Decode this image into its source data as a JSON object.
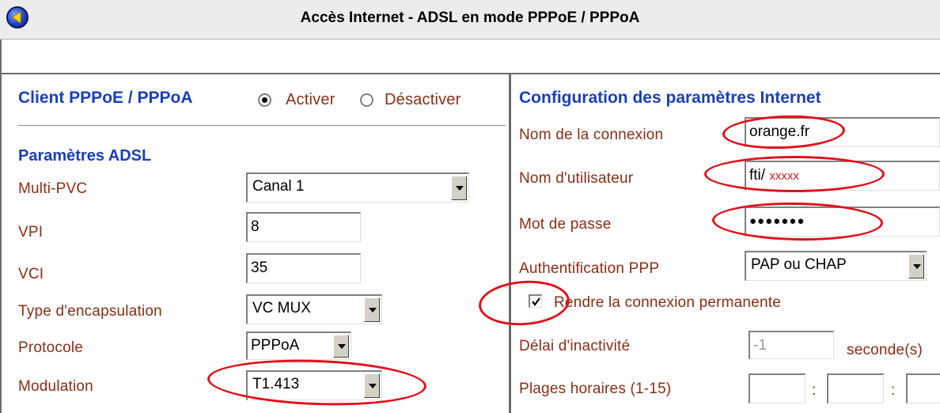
{
  "window": {
    "title": "Accès Internet - ADSL en mode PPPoE / PPPoA",
    "back_icon": "back-arrow-icon"
  },
  "left": {
    "client_label": "Client PPPoE / PPPoA",
    "activate_label": "Activer",
    "deactivate_label": "Désactiver",
    "client_selected": "Activer",
    "adsl_heading": "Paramètres ADSL",
    "fields": {
      "multipvc": {
        "label": "Multi-PVC",
        "value": "Canal 1"
      },
      "vpi": {
        "label": "VPI",
        "value": "8"
      },
      "vci": {
        "label": "VCI",
        "value": "35"
      },
      "encapsulation": {
        "label": "Type d'encapsulation",
        "value": "VC MUX"
      },
      "protocol": {
        "label": "Protocole",
        "value": "PPPoA"
      },
      "modulation": {
        "label": "Modulation",
        "value": "T1.413"
      }
    }
  },
  "right": {
    "heading": "Configuration des paramètres Internet",
    "fields": {
      "connection_name": {
        "label": "Nom de la connexion",
        "value": "orange.fr"
      },
      "username": {
        "label": "Nom d'utilisateur",
        "value_prefix": "fti/",
        "value_masked": "xxxxx"
      },
      "password": {
        "label": "Mot de passe",
        "value": "●●●●●●●"
      },
      "auth": {
        "label": "Authentification PPP",
        "value": "PAP ou CHAP"
      },
      "permanent": {
        "label": "Rendre la connexion permanente",
        "checked": true
      },
      "idle": {
        "label": "Délai d'inactivité",
        "value": "-1",
        "unit": "seconde(s)"
      },
      "schedule": {
        "label": "Plages horaires (1-15)",
        "separator": ":"
      }
    }
  },
  "annotation_color": "#e0101a"
}
